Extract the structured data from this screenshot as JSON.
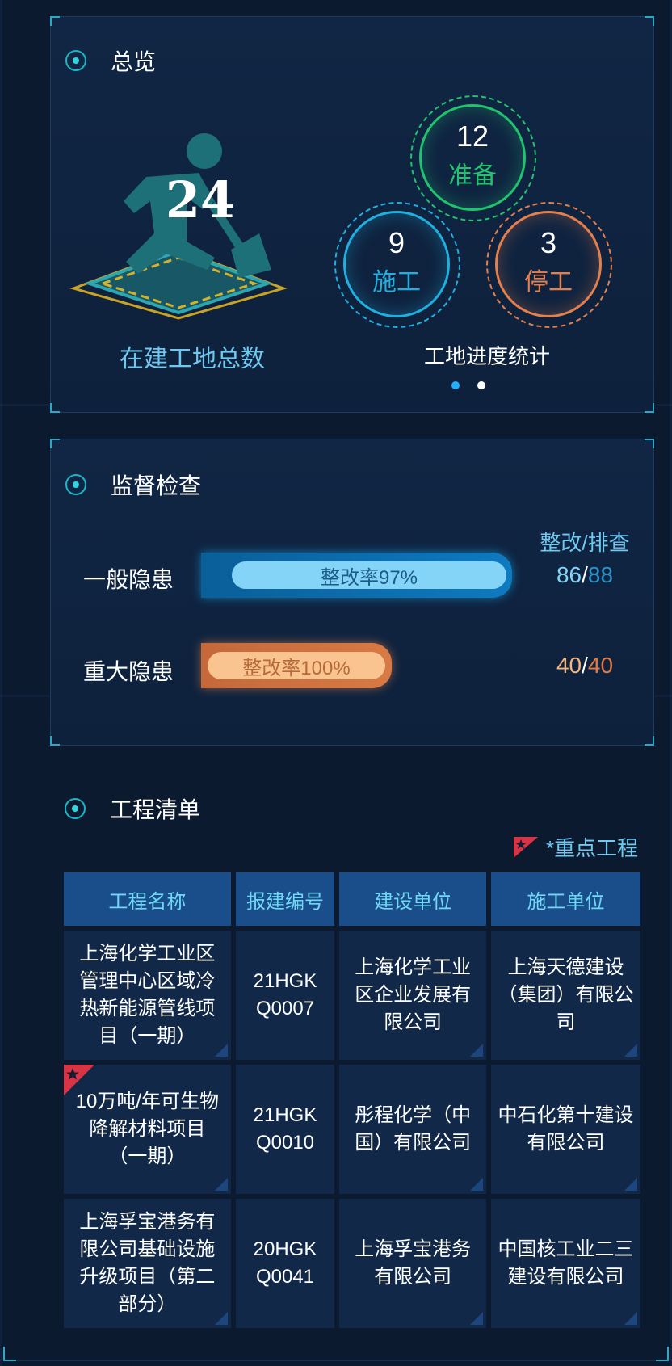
{
  "overview": {
    "title": "总览",
    "total_count": "24",
    "total_label": "在建工地总数",
    "progress_label": "工地进度统计",
    "stats": [
      {
        "count": "12",
        "label": "准备",
        "color": "#21c46e"
      },
      {
        "count": "9",
        "label": "施工",
        "color": "#1fb0e0"
      },
      {
        "count": "3",
        "label": "停工",
        "color": "#e47f4e"
      }
    ],
    "carousel_active": 0
  },
  "inspection": {
    "title": "监督检查",
    "ratio_header": "整改/排查",
    "rows": [
      {
        "label": "一般隐患",
        "rate_text": "整改率97%",
        "rate": 0.97,
        "fixed": "86",
        "total": "88"
      },
      {
        "label": "重大隐患",
        "rate_text": "整改率100%",
        "rate": 1.0,
        "fixed": "40",
        "total": "40"
      }
    ]
  },
  "projects": {
    "title": "工程清单",
    "legend": "*重点工程",
    "columns": [
      "工程名称",
      "报建编号",
      "建设单位",
      "施工单位"
    ],
    "rows": [
      {
        "name": "上海化学工业区管理中心区域冷热新能源管线项目（一期）",
        "code": "21HGK Q0007",
        "builder": "上海化学工业区企业发展有限公司",
        "contractor": "上海天德建设（集团）有限公司",
        "key": false
      },
      {
        "name": "10万吨/年可生物降解材料项目（一期）",
        "code": "21HGK Q0010",
        "builder": "彤程化学（中国）有限公司",
        "contractor": "中石化第十建设有限公司",
        "key": true
      },
      {
        "name": "上海孚宝港务有限公司基础设施升级项目（第二部分）",
        "code": "20HGK Q0041",
        "builder": "上海孚宝港务有限公司",
        "contractor": "中国核工业二三建设有限公司",
        "key": false
      }
    ]
  }
}
